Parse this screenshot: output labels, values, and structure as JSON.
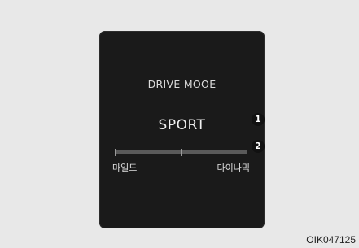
{
  "display": {
    "title": "DRIVE MOOE",
    "mode": "SPORT",
    "scale_left": "마일드",
    "scale_right": "다이나믹"
  },
  "callouts": [
    "1",
    "2"
  ],
  "image_code": "OIK047125"
}
